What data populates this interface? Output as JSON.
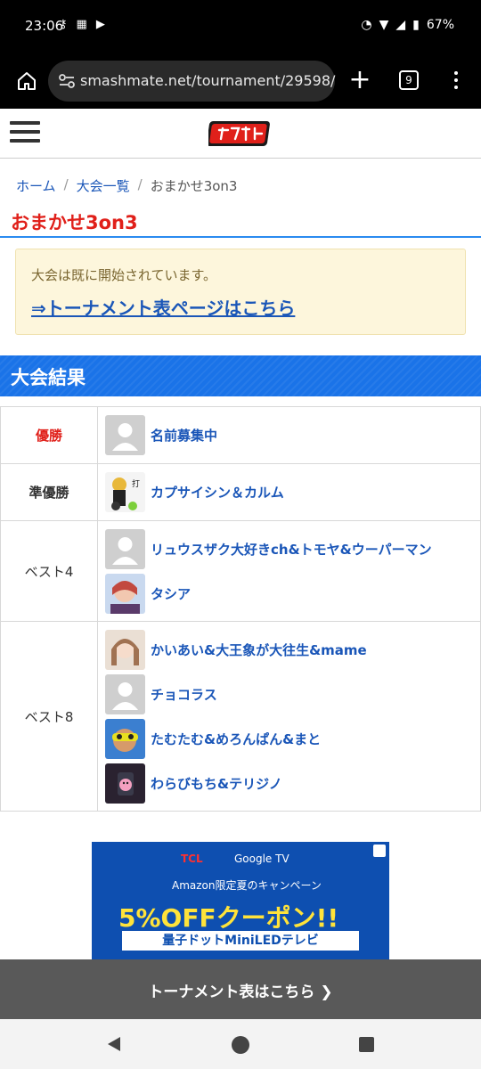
{
  "status_bar": {
    "time": "23:06",
    "battery": "67%"
  },
  "browser": {
    "url": "smashmate.net/tournament/29598/",
    "tab_count": "9"
  },
  "breadcrumb": {
    "home": "ホーム",
    "list": "大会一覧",
    "current": "おまかせ3on3"
  },
  "page_title": "おまかせ3on3",
  "notice": {
    "message": "大会は既に開始されています。",
    "link": "⇒トーナメント表ページはこちら"
  },
  "results": {
    "heading": "大会結果",
    "rows": [
      {
        "rank": "優勝",
        "players": [
          "名前募集中"
        ]
      },
      {
        "rank": "準優勝",
        "players": [
          "カプサイシン＆カルム"
        ]
      },
      {
        "rank": "ベスト4",
        "players": [
          "リュウスザク大好きch&トモヤ&ウーパーマン",
          "タシア"
        ]
      },
      {
        "rank": "ベスト8",
        "players": [
          "かいあい&大王象が大往生&mame",
          "チョコラス",
          "たむたむ&めろんぱん&まと",
          "わらびもち&テリジノ"
        ]
      }
    ]
  },
  "ad": {
    "brand": "TCL",
    "partner": "Google TV",
    "campaign": "Amazon限定夏のキャンペーン",
    "headline": "5%OFFクーポン!!",
    "product": "量子ドットMiniLEDテレビ"
  },
  "bottom_bar": {
    "label": "トーナメント表はこちら ❯"
  },
  "colors": {
    "accent_blue": "#1a73e8",
    "title_red": "#e0201a",
    "link_blue": "#1a56b8"
  }
}
